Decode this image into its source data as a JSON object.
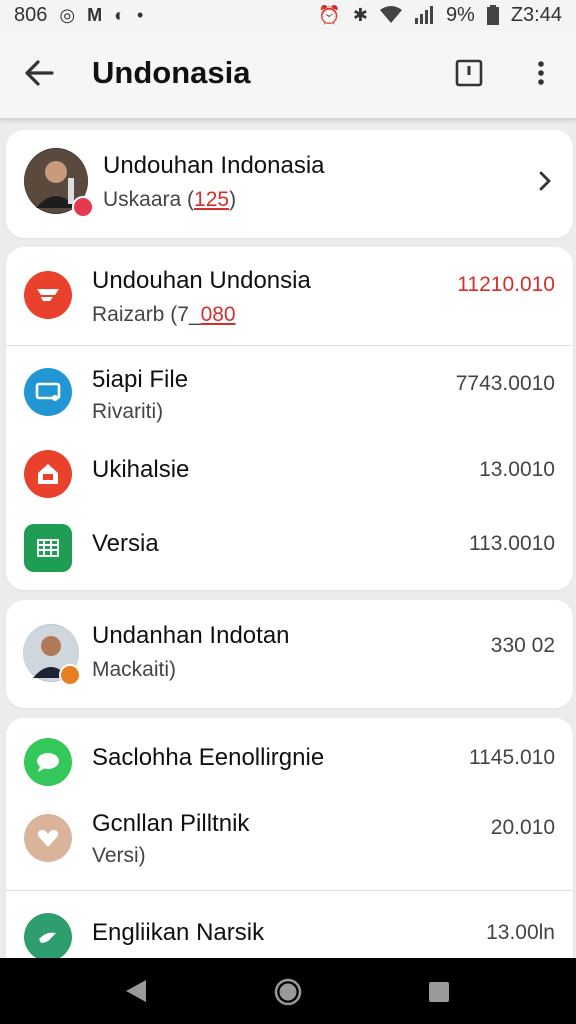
{
  "status": {
    "left": [
      "806",
      "◎",
      "M",
      "◐",
      "•"
    ],
    "battery": "9%",
    "time": "Z3:44"
  },
  "appbar": {
    "title": "Undonasia",
    "icons": [
      "back-arrow-icon",
      "flag-icon",
      "more-vert-icon"
    ]
  },
  "profile": {
    "name": "Undouhan Indonasia",
    "sub_prefix": "Uskaara (",
    "sub_highlight": "125",
    "sub_suffix": ")"
  },
  "card1": [
    {
      "title": "Undouhan Undonsia",
      "sub_prefix": "Raizarb (7_",
      "sub_highlight": "080",
      "value": "11210.010",
      "icon": "red-logo-icon",
      "color": "#e8412c"
    },
    {
      "title": "5iapi  File",
      "sub": "Rivariti)",
      "value": "7743.0010",
      "icon": "screen-icon",
      "color": "#2196d3"
    },
    {
      "title": "Ukihalsie",
      "value": "13.0010",
      "icon": "home-icon",
      "color": "#e8412c"
    },
    {
      "title": "Versia",
      "value": "113.0010",
      "icon": "sheet-icon",
      "color": "#1e9e55"
    }
  ],
  "card2": {
    "title": "Undanhan Indotan",
    "sub": "Mackaiti)",
    "value": "330 02"
  },
  "card3": [
    {
      "title": "Saclohha Eenollirgnie",
      "value": "1145.010",
      "icon": "chat-icon",
      "color": "#34c759"
    },
    {
      "title": "Gcnllan Pilltnik",
      "sub": "Versi)",
      "value": "20.010",
      "icon": "heart-icon",
      "color": "#d9b49a"
    },
    {
      "title": "Engliikan Narsik",
      "value": "13.00ln",
      "icon": "bird-icon",
      "color": "#2e9e6e"
    }
  ],
  "colors": {
    "accent_red": "#d32f2f",
    "nav_bg": "#000000"
  }
}
